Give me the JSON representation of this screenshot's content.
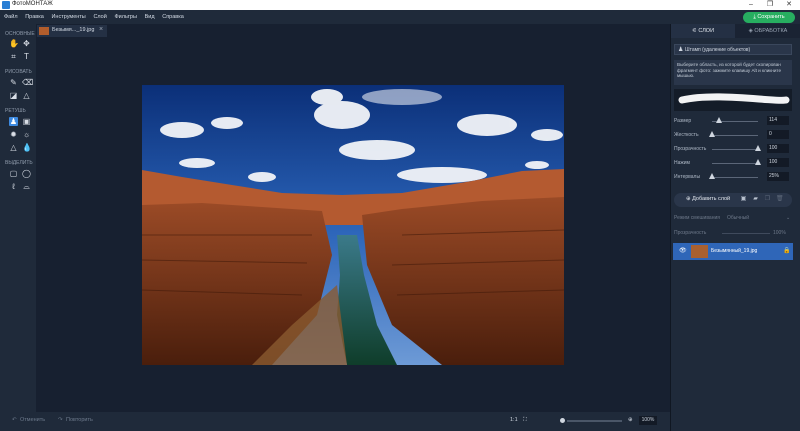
{
  "app": {
    "title": "ФотоМОНТАЖ"
  },
  "window_controls": {
    "minimize": "–",
    "maximize": "❐",
    "close": "✕"
  },
  "menu": [
    "Файл",
    "Правка",
    "Инструменты",
    "Слой",
    "Фильтры",
    "Вид",
    "Справка"
  ],
  "save_button": "Сохранить",
  "tools": {
    "sections": [
      "ОСНОВНЫЕ",
      "РИСОВАТЬ",
      "РЕТУШЬ",
      "ВЫДЕЛИТЬ"
    ]
  },
  "file_tab": {
    "name": "Безымя..._19.jpg",
    "close": "×"
  },
  "bottom": {
    "undo": "Отменить",
    "redo": "Повторить",
    "ratio": "1:1",
    "zoom": "100%"
  },
  "right_panel": {
    "tabs": [
      "СЛОИ",
      "ОБРАБОТКА"
    ],
    "brush_select": "Штамп (удаление объектов)",
    "hint": "Выберите область, из которой будет скопирован фрагмент фото: зажмите клавишу Alt и кликните мышью.",
    "sliders": [
      {
        "label": "Размер",
        "value": "114",
        "pos": 0.15
      },
      {
        "label": "Жесткость",
        "value": "0",
        "pos": 0.0
      },
      {
        "label": "Прозрачность",
        "value": "100",
        "pos": 1.0
      },
      {
        "label": "Нажим",
        "value": "100",
        "pos": 1.0
      },
      {
        "label": "Интервалы",
        "value": "25%",
        "pos": 0.0
      }
    ],
    "add_layer": "Добавить слой",
    "blend_mode_label": "Режим смешивания",
    "blend_mode_value": "Обычный",
    "opacity_label": "Прозрачность",
    "opacity_value": "100%",
    "layer_name": "Безымянный_19.jpg"
  },
  "colors": {
    "accent": "#27ae60",
    "selection": "#2f66b8",
    "tool_active": "#3d8ae0"
  }
}
